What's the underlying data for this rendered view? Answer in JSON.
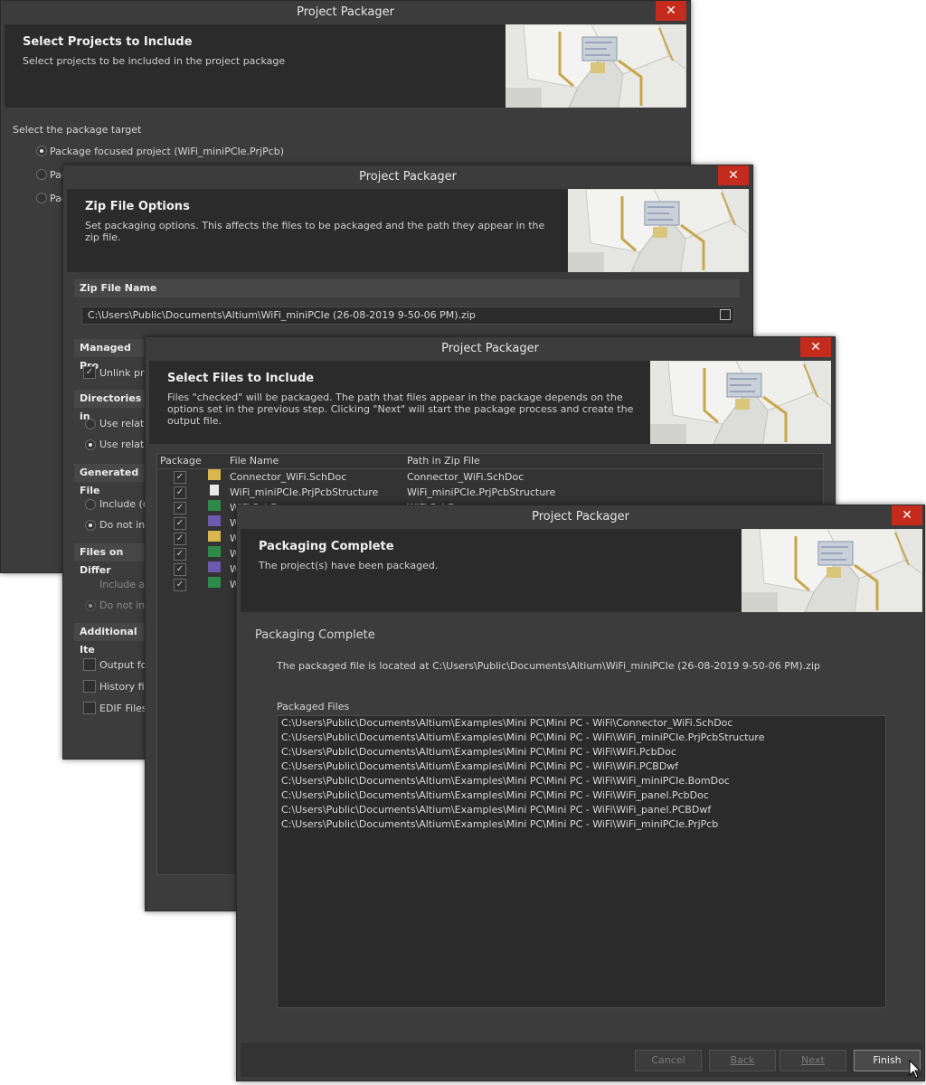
{
  "colors": {
    "window_bg": "#3c3c3c",
    "header_bg": "#2b2b2b",
    "close_bg": "#c42b1c",
    "section_bg": "#474747"
  },
  "win1": {
    "title": "Project Packager",
    "header_title": "Select Projects to Include",
    "header_sub": "Select projects to be included in the project package",
    "target_label": "Select the package target",
    "options": [
      "Package focused project (WiFi_miniPCIe.PrjPcb)",
      "Pac",
      "Pac"
    ]
  },
  "win2": {
    "title": "Project Packager",
    "header_title": "Zip File Options",
    "header_sub_1": "Set packaging options. This affects the files to be packaged and the path they appear in the",
    "header_sub_2": "zip file.",
    "zip_section": "Zip File Name",
    "zip_path": "C:\\Users\\Public\\Documents\\Altium\\WiFi_miniPCIe (26-08-2019 9-50-06 PM).zip",
    "managed_section": "Managed Pro",
    "unlink_label": "Unlink pro",
    "dirs_section": "Directories in",
    "use_rel_1": "Use relativ",
    "use_rel_2": "Use relativ",
    "generated_section": "Generated File",
    "include_label": "Include (or",
    "do_not_label": "Do not inc",
    "files_diff_section": "Files on Differ",
    "include_a_label": "Include a p",
    "do_not_inc_label": "Do not inc",
    "additional_section": "Additional Ite",
    "output_label": "Output fo",
    "history_label": "History file",
    "edif_label": "EDIF Files"
  },
  "win3": {
    "title": "Project Packager",
    "header_title": "Select Files to Include",
    "header_sub_1": "Files \"checked\" will be packaged. The path that files appear in the package depends on the",
    "header_sub_2": "options set in the previous step. Clicking \"Next\" will start the package process and create the",
    "header_sub_3": "output file.",
    "col_package": "Package",
    "col_file": "File Name",
    "col_path": "Path in Zip File",
    "rows": [
      {
        "file": "Connector_WiFi.SchDoc",
        "path": "Connector_WiFi.SchDoc"
      },
      {
        "file": "WiFi_miniPCIe.PrjPcbStructure",
        "path": "WiFi_miniPCIe.PrjPcbStructure"
      },
      {
        "file": "WiFi.PcbDoc",
        "path": "WiFi.PcbDoc"
      },
      {
        "file": "W",
        "path": ""
      },
      {
        "file": "W",
        "path": ""
      },
      {
        "file": "W",
        "path": ""
      },
      {
        "file": "W",
        "path": ""
      },
      {
        "file": "W",
        "path": ""
      }
    ]
  },
  "win4": {
    "title": "Project Packager",
    "header_title": "Packaging Complete",
    "header_sub": "The project(s) have been packaged.",
    "body_title": "Packaging Complete",
    "located_text": "The packaged file is located at C:\\Users\\Public\\Documents\\Altium\\WiFi_miniPCIe (26-08-2019 9-50-06 PM).zip",
    "packaged_label": "Packaged Files",
    "files": [
      "C:\\Users\\Public\\Documents\\Altium\\Examples\\Mini PC\\Mini PC - WiFi\\Connector_WiFi.SchDoc",
      "C:\\Users\\Public\\Documents\\Altium\\Examples\\Mini PC\\Mini PC - WiFi\\WiFi_miniPCIe.PrjPcbStructure",
      "C:\\Users\\Public\\Documents\\Altium\\Examples\\Mini PC\\Mini PC - WiFi\\WiFi.PcbDoc",
      "C:\\Users\\Public\\Documents\\Altium\\Examples\\Mini PC\\Mini PC - WiFi\\WiFi.PCBDwf",
      "C:\\Users\\Public\\Documents\\Altium\\Examples\\Mini PC\\Mini PC - WiFi\\WiFi_miniPCIe.BomDoc",
      "C:\\Users\\Public\\Documents\\Altium\\Examples\\Mini PC\\Mini PC - WiFi\\WiFi_panel.PcbDoc",
      "C:\\Users\\Public\\Documents\\Altium\\Examples\\Mini PC\\Mini PC - WiFi\\WiFi_panel.PCBDwf",
      "C:\\Users\\Public\\Documents\\Altium\\Examples\\Mini PC\\Mini PC - WiFi\\WiFi_miniPCIe.PrjPcb"
    ],
    "cancel_label": "Cancel",
    "back_label": "Back",
    "next_label": "Next",
    "finish_label": "Finish"
  },
  "close_glyph": "✕",
  "check_glyph": "✓"
}
